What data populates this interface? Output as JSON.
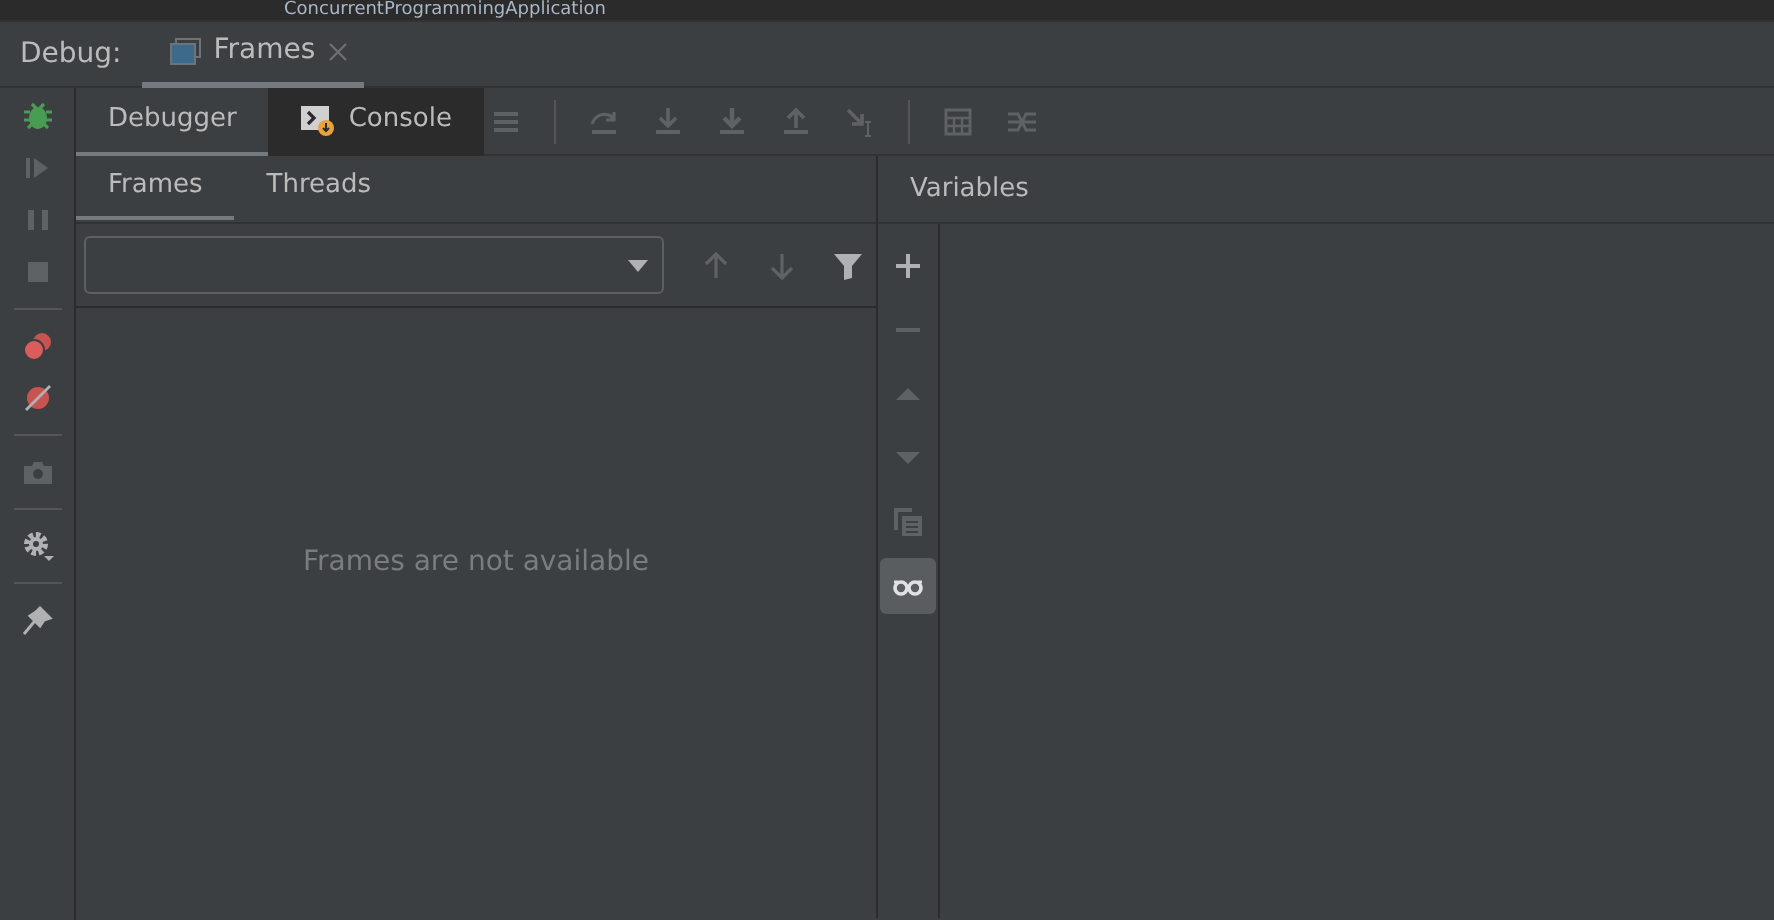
{
  "editor_tab": {
    "title": "ConcurrentProgrammingApplication"
  },
  "debug_bar": {
    "label": "Debug:",
    "tabs": [
      {
        "label": "Frames",
        "selected": true
      }
    ]
  },
  "side_toolbar": [
    {
      "kind": "bug",
      "disabled": false
    },
    {
      "kind": "resume",
      "disabled": true
    },
    {
      "kind": "pause",
      "disabled": true
    },
    {
      "kind": "stop",
      "disabled": true
    },
    {
      "kind": "sep"
    },
    {
      "kind": "breakpoints",
      "disabled": false
    },
    {
      "kind": "mute",
      "disabled": false
    },
    {
      "kind": "sep"
    },
    {
      "kind": "camera",
      "disabled": true
    },
    {
      "kind": "sep"
    },
    {
      "kind": "gear",
      "disabled": false
    },
    {
      "kind": "sep"
    },
    {
      "kind": "pin",
      "disabled": false
    }
  ],
  "tool_tabs": [
    {
      "label": "Debugger",
      "selected": true,
      "kind": "plain"
    },
    {
      "label": "Console",
      "selected": false,
      "kind": "console"
    }
  ],
  "step_toolbar": [
    {
      "kind": "list",
      "disabled": true
    },
    {
      "kind": "sep"
    },
    {
      "kind": "stepover",
      "disabled": true
    },
    {
      "kind": "stepinto",
      "disabled": true
    },
    {
      "kind": "forceinto",
      "disabled": true
    },
    {
      "kind": "stepout",
      "disabled": true
    },
    {
      "kind": "cursor",
      "disabled": true
    },
    {
      "kind": "sep"
    },
    {
      "kind": "calc",
      "disabled": true
    },
    {
      "kind": "trace",
      "disabled": true
    }
  ],
  "frames_tabs": [
    {
      "label": "Frames",
      "selected": true
    },
    {
      "label": "Threads",
      "selected": false
    }
  ],
  "frames_toolbar": [
    {
      "kind": "up",
      "disabled": true
    },
    {
      "kind": "down",
      "disabled": true
    },
    {
      "kind": "filter",
      "disabled": false
    }
  ],
  "frames": {
    "empty_message": "Frames are not available"
  },
  "variables": {
    "title": "Variables"
  },
  "variables_toolbar": [
    {
      "kind": "plus",
      "disabled": false,
      "selected": false
    },
    {
      "kind": "minus",
      "disabled": true,
      "selected": false
    },
    {
      "kind": "tri-up",
      "disabled": true,
      "selected": false
    },
    {
      "kind": "tri-down",
      "disabled": true,
      "selected": false
    },
    {
      "kind": "copy",
      "disabled": true,
      "selected": false
    },
    {
      "kind": "glasses",
      "disabled": false,
      "selected": true
    }
  ]
}
